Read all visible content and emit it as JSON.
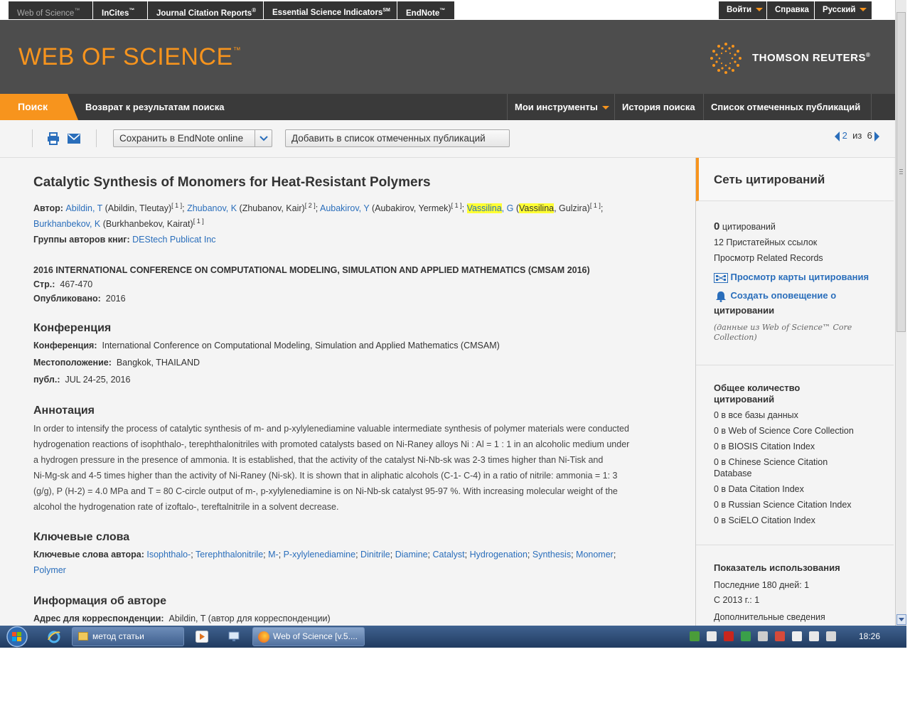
{
  "topbar": {
    "products": [
      "Web of Science",
      "InCites",
      "Journal Citation Reports",
      "Essential Science Indicators",
      "EndNote"
    ],
    "product_marks": [
      "™",
      "™",
      "®",
      "SM",
      "™"
    ],
    "login": "Войти",
    "help": "Справка",
    "language": "Русский"
  },
  "header": {
    "logo": "WEB OF SCIENCE",
    "logo_mark": "™",
    "brand": "THOMSON REUTERS",
    "brand_mark": "®"
  },
  "nav": {
    "search": "Поиск",
    "back": "Возврат к результатам поиска",
    "my_tools": "Мои инструменты",
    "search_history": "История поиска",
    "marked_list": "Список отмеченных публикаций"
  },
  "toolbar": {
    "save_endnote": "Сохранить в EndNote online",
    "add_marked": "Добавить в список отмеченных публикаций",
    "page_current": "2",
    "page_of": "из",
    "page_total": "6"
  },
  "record": {
    "title": "Catalytic Synthesis of Monomers for Heat-Resistant Polymers",
    "author_label": "Автор:",
    "authors": [
      {
        "short": "Abildin, T",
        "full": "(Abildin, Tleutay)",
        "ref": "[ 1 ]"
      },
      {
        "short": "Zhubanov, K",
        "full": "(Zhubanov, Kair)",
        "ref": "[ 2 ]"
      },
      {
        "short": "Aubakirov, Y",
        "full": "(Aubakirov, Yermek)",
        "ref": "[ 1 ]"
      },
      {
        "short_hl": "Vassilina",
        "short_rest": ", G",
        "full_open": "(",
        "full_hl": "Vassilina",
        "full_rest": ", Gulzira)",
        "ref": "[ 1 ]"
      },
      {
        "short": "Burkhanbekov, K",
        "full": "(Burkhanbekov, Kairat)",
        "ref": "[ 1 ]"
      }
    ],
    "group_label": "Группы авторов книг:",
    "group_value": "DEStech Publicat Inc",
    "source": "2016 INTERNATIONAL CONFERENCE ON COMPUTATIONAL MODELING, SIMULATION AND APPLIED MATHEMATICS (CMSAM 2016)",
    "pages_label": "Стр.:",
    "pages_value": "467-470",
    "published_label": "Опубликовано:",
    "published_value": "2016",
    "conference_heading": "Конференция",
    "conf_label": "Конференция:",
    "conf_value": "International Conference on Computational Modeling, Simulation and Applied Mathematics (CMSAM)",
    "location_label": "Местоположение:",
    "location_value": "Bangkok, THAILAND",
    "pub_label": "публ.:",
    "pub_value": "JUL 24-25, 2016",
    "abstract_heading": "Аннотация",
    "abstract_lines": [
      "In order to intensify the process of catalytic synthesis of m- and p-xylylenediamine valuable intermediate synthesis of polymer materials were conducted",
      "hydrogenation reactions of isophthalo-, terephthalonitriles with promoted catalysts based on Ni-Raney alloys Ni : Al = 1 : 1 in an alcoholic medium under",
      "a hydrogen pressure in the presence of ammonia. It is established, that the activity of the catalyst Ni-Nb-sk was 2-3 times higher than Ni-Tisk and",
      "Ni-Mg-sk and 4-5 times higher than the activity of Ni-Raney (Ni-sk). It is shown that in aliphatic alcohols (C-1- C-4) in a ratio of nitrile: ammonia = 1: 3",
      "(g/g), P (H-2) = 4.0 MPa and T = 80 C-circle output of m-, p-xylylenediamine is on Ni-Nb-sk catalyst 95-97 %. With increasing molecular weight of the",
      "alcohol the hydrogenation rate of izoftalo-, tereftalnitrile in a solvent decrease."
    ],
    "keywords_heading": "Ключевые слова",
    "keywords_label": "Ключевые слова автора:",
    "keywords": [
      "Isophthalo-",
      "Terephthalonitrile",
      "M-",
      "P-xylylenediamine",
      "Dinitrile",
      "Diamine",
      "Catalyst",
      "Hydrogenation",
      "Synthesis",
      "Monomer",
      "Polymer"
    ],
    "author_info_heading": "Информация об авторе",
    "address_label": "Адрес для корреспонденции:",
    "address_value": "Abildin, T (автор для корреспонденции)"
  },
  "sidebar": {
    "heading": "Сеть цитирований",
    "citations_count": "0",
    "citations_label": "цитирований",
    "cited_refs": "12 Пристатейных ссылок",
    "related": "Просмотр Related Records",
    "citation_map": "Просмотр карты цитирования",
    "alert_line1": "Создать оповещение о",
    "alert_line2": "цитировании",
    "note_line1_pre": "(данные из",
    "note_line1_em": "Web of Science",
    "note_line1_post": "™ Core",
    "note_line2": "Collection)",
    "total_heading_1": "Общее количество",
    "total_heading_2": "цитирований",
    "totals": [
      "0 в все базы данных",
      "0 в Web of Science Core Collection",
      "0 в BIOSIS Citation Index",
      "0 в Chinese Science Citation",
      "Database",
      "0 в Data Citation Index",
      "0 в Russian Science Citation Index",
      "0 в SciELO Citation Index"
    ],
    "usage_heading": "Показатель использования",
    "usage_180": "Последние 180 дней: 1",
    "usage_2013": "С 2013 г.: 1",
    "more_info": "Дополнительные сведения"
  },
  "taskbar": {
    "task1": "метод статьи",
    "task2": "Web of Science [v.5....",
    "clock": "18:26"
  },
  "colors": {
    "accent": "#f7941d",
    "link": "#2a6ebb",
    "highlight": "#ffff33",
    "header_bg": "#4d4d4d"
  }
}
